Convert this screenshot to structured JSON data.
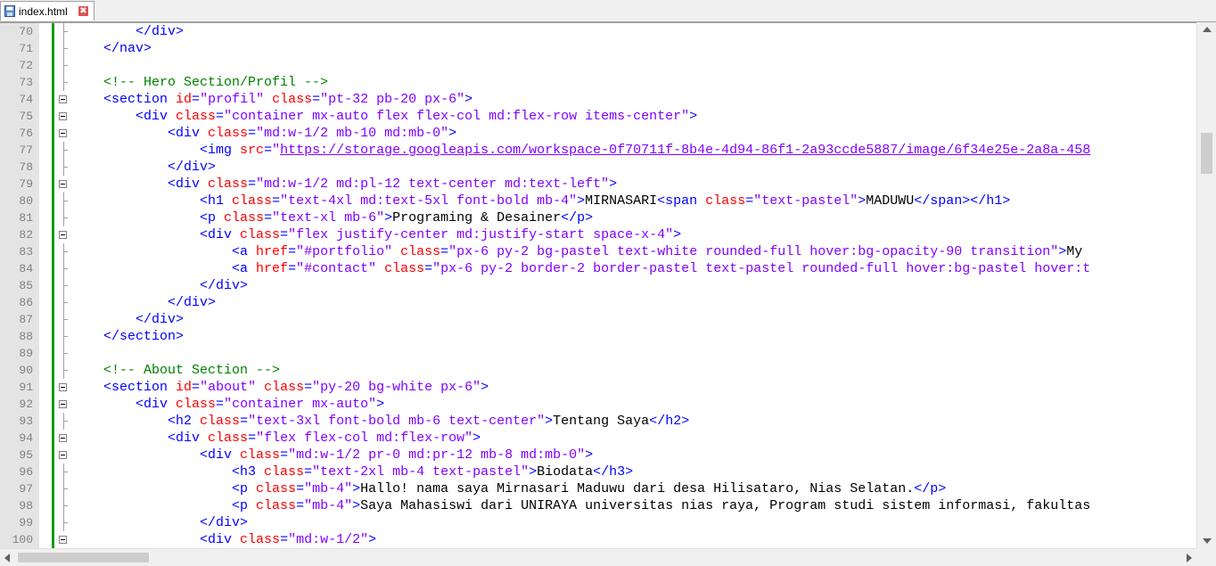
{
  "tab": {
    "filename": "index.html",
    "icon": "file-save-icon",
    "close": "✖"
  },
  "colors": {
    "tag": "#0000ff",
    "attr": "#ff0000",
    "string": "#8000ff",
    "comment": "#008000",
    "text": "#000000",
    "change_bar": "#10a010"
  },
  "fold_lines": [
    74,
    75,
    76,
    79,
    82,
    91,
    92,
    94,
    95,
    100
  ],
  "lines": [
    {
      "n": "70",
      "tokens": [
        [
          "",
          "        "
        ],
        [
          "tag",
          "</div>"
        ]
      ]
    },
    {
      "n": "71",
      "tokens": [
        [
          "",
          "    "
        ],
        [
          "tag",
          "</nav>"
        ]
      ]
    },
    {
      "n": "72",
      "tokens": []
    },
    {
      "n": "73",
      "tokens": [
        [
          "",
          "    "
        ],
        [
          "com",
          "<!-- Hero Section/Profil -->"
        ]
      ]
    },
    {
      "n": "74",
      "tokens": [
        [
          "",
          "    "
        ],
        [
          "tag",
          "<section "
        ],
        [
          "attr",
          "id"
        ],
        [
          "tag",
          "="
        ],
        [
          "str",
          "\"profil\""
        ],
        [
          "tag",
          " "
        ],
        [
          "attr",
          "class"
        ],
        [
          "tag",
          "="
        ],
        [
          "str",
          "\"pt-32 pb-20 px-6\""
        ],
        [
          "tag",
          ">"
        ]
      ]
    },
    {
      "n": "75",
      "tokens": [
        [
          "",
          "        "
        ],
        [
          "tag",
          "<div "
        ],
        [
          "attr",
          "class"
        ],
        [
          "tag",
          "="
        ],
        [
          "str",
          "\"container mx-auto flex flex-col md:flex-row items-center\""
        ],
        [
          "tag",
          ">"
        ]
      ]
    },
    {
      "n": "76",
      "tokens": [
        [
          "",
          "            "
        ],
        [
          "tag",
          "<div "
        ],
        [
          "attr",
          "class"
        ],
        [
          "tag",
          "="
        ],
        [
          "str",
          "\"md:w-1/2 mb-10 md:mb-0\""
        ],
        [
          "tag",
          ">"
        ]
      ]
    },
    {
      "n": "77",
      "tokens": [
        [
          "",
          "                "
        ],
        [
          "tag",
          "<img "
        ],
        [
          "attr",
          "src"
        ],
        [
          "tag",
          "="
        ],
        [
          "str",
          "\""
        ],
        [
          "url",
          "https://storage.googleapis.com/workspace-0f70711f-8b4e-4d94-86f1-2a93ccde5887/image/6f34e25e-2a8a-458"
        ]
      ]
    },
    {
      "n": "78",
      "tokens": [
        [
          "",
          "            "
        ],
        [
          "tag",
          "</div>"
        ]
      ]
    },
    {
      "n": "79",
      "tokens": [
        [
          "",
          "            "
        ],
        [
          "tag",
          "<div "
        ],
        [
          "attr",
          "class"
        ],
        [
          "tag",
          "="
        ],
        [
          "str",
          "\"md:w-1/2 md:pl-12 text-center md:text-left\""
        ],
        [
          "tag",
          ">"
        ]
      ]
    },
    {
      "n": "80",
      "tokens": [
        [
          "",
          "                "
        ],
        [
          "tag",
          "<h1 "
        ],
        [
          "attr",
          "class"
        ],
        [
          "tag",
          "="
        ],
        [
          "str",
          "\"text-4xl md:text-5xl font-bold mb-4\""
        ],
        [
          "tag",
          ">"
        ],
        [
          "text",
          "MIRNASARI"
        ],
        [
          "tag",
          "<span "
        ],
        [
          "attr",
          "class"
        ],
        [
          "tag",
          "="
        ],
        [
          "str",
          "\"text-pastel\""
        ],
        [
          "tag",
          ">"
        ],
        [
          "text",
          "MADUWU"
        ],
        [
          "tag",
          "</span></h1>"
        ]
      ]
    },
    {
      "n": "81",
      "tokens": [
        [
          "",
          "                "
        ],
        [
          "tag",
          "<p "
        ],
        [
          "attr",
          "class"
        ],
        [
          "tag",
          "="
        ],
        [
          "str",
          "\"text-xl mb-6\""
        ],
        [
          "tag",
          ">"
        ],
        [
          "text",
          "Programing & Desainer"
        ],
        [
          "tag",
          "</p>"
        ]
      ]
    },
    {
      "n": "82",
      "tokens": [
        [
          "",
          "                "
        ],
        [
          "tag",
          "<div "
        ],
        [
          "attr",
          "class"
        ],
        [
          "tag",
          "="
        ],
        [
          "str",
          "\"flex justify-center md:justify-start space-x-4\""
        ],
        [
          "tag",
          ">"
        ]
      ]
    },
    {
      "n": "83",
      "tokens": [
        [
          "",
          "                    "
        ],
        [
          "tag",
          "<a "
        ],
        [
          "attr",
          "href"
        ],
        [
          "tag",
          "="
        ],
        [
          "str",
          "\"#portfolio\""
        ],
        [
          "tag",
          " "
        ],
        [
          "attr",
          "class"
        ],
        [
          "tag",
          "="
        ],
        [
          "str",
          "\"px-6 py-2 bg-pastel text-white rounded-full hover:bg-opacity-90 transition\""
        ],
        [
          "tag",
          ">"
        ],
        [
          "text",
          "My"
        ]
      ]
    },
    {
      "n": "84",
      "tokens": [
        [
          "",
          "                    "
        ],
        [
          "tag",
          "<a "
        ],
        [
          "attr",
          "href"
        ],
        [
          "tag",
          "="
        ],
        [
          "str",
          "\"#contact\""
        ],
        [
          "tag",
          " "
        ],
        [
          "attr",
          "class"
        ],
        [
          "tag",
          "="
        ],
        [
          "str",
          "\"px-6 py-2 border-2 border-pastel text-pastel rounded-full hover:bg-pastel hover:t"
        ]
      ]
    },
    {
      "n": "85",
      "tokens": [
        [
          "",
          "                "
        ],
        [
          "tag",
          "</div>"
        ]
      ]
    },
    {
      "n": "86",
      "tokens": [
        [
          "",
          "            "
        ],
        [
          "tag",
          "</div>"
        ]
      ]
    },
    {
      "n": "87",
      "tokens": [
        [
          "",
          "        "
        ],
        [
          "tag",
          "</div>"
        ]
      ]
    },
    {
      "n": "88",
      "tokens": [
        [
          "",
          "    "
        ],
        [
          "tag",
          "</section>"
        ]
      ]
    },
    {
      "n": "89",
      "tokens": []
    },
    {
      "n": "90",
      "tokens": [
        [
          "",
          "    "
        ],
        [
          "com",
          "<!-- About Section -->"
        ]
      ]
    },
    {
      "n": "91",
      "tokens": [
        [
          "",
          "    "
        ],
        [
          "tag",
          "<section "
        ],
        [
          "attr",
          "id"
        ],
        [
          "tag",
          "="
        ],
        [
          "str",
          "\"about\""
        ],
        [
          "tag",
          " "
        ],
        [
          "attr",
          "class"
        ],
        [
          "tag",
          "="
        ],
        [
          "str",
          "\"py-20 bg-white px-6\""
        ],
        [
          "tag",
          ">"
        ]
      ]
    },
    {
      "n": "92",
      "tokens": [
        [
          "",
          "        "
        ],
        [
          "tag",
          "<div "
        ],
        [
          "attr",
          "class"
        ],
        [
          "tag",
          "="
        ],
        [
          "str",
          "\"container mx-auto\""
        ],
        [
          "tag",
          ">"
        ]
      ]
    },
    {
      "n": "93",
      "tokens": [
        [
          "",
          "            "
        ],
        [
          "tag",
          "<h2 "
        ],
        [
          "attr",
          "class"
        ],
        [
          "tag",
          "="
        ],
        [
          "str",
          "\"text-3xl font-bold mb-6 text-center\""
        ],
        [
          "tag",
          ">"
        ],
        [
          "text",
          "Tentang Saya"
        ],
        [
          "tag",
          "</h2>"
        ]
      ]
    },
    {
      "n": "94",
      "tokens": [
        [
          "",
          "            "
        ],
        [
          "tag",
          "<div "
        ],
        [
          "attr",
          "class"
        ],
        [
          "tag",
          "="
        ],
        [
          "str",
          "\"flex flex-col md:flex-row\""
        ],
        [
          "tag",
          ">"
        ]
      ]
    },
    {
      "n": "95",
      "tokens": [
        [
          "",
          "                "
        ],
        [
          "tag",
          "<div "
        ],
        [
          "attr",
          "class"
        ],
        [
          "tag",
          "="
        ],
        [
          "str",
          "\"md:w-1/2 pr-0 md:pr-12 mb-8 md:mb-0\""
        ],
        [
          "tag",
          ">"
        ]
      ]
    },
    {
      "n": "96",
      "tokens": [
        [
          "",
          "                    "
        ],
        [
          "tag",
          "<h3 "
        ],
        [
          "attr",
          "class"
        ],
        [
          "tag",
          "="
        ],
        [
          "str",
          "\"text-2xl mb-4 text-pastel\""
        ],
        [
          "tag",
          ">"
        ],
        [
          "text",
          "Biodata"
        ],
        [
          "tag",
          "</h3>"
        ]
      ]
    },
    {
      "n": "97",
      "tokens": [
        [
          "",
          "                    "
        ],
        [
          "tag",
          "<p "
        ],
        [
          "attr",
          "class"
        ],
        [
          "tag",
          "="
        ],
        [
          "str",
          "\"mb-4\""
        ],
        [
          "tag",
          ">"
        ],
        [
          "text",
          "Hallo! nama saya Mirnasari Maduwu dari desa Hilisataro, Nias Selatan."
        ],
        [
          "tag",
          "</p>"
        ]
      ]
    },
    {
      "n": "98",
      "tokens": [
        [
          "",
          "                    "
        ],
        [
          "tag",
          "<p "
        ],
        [
          "attr",
          "class"
        ],
        [
          "tag",
          "="
        ],
        [
          "str",
          "\"mb-4\""
        ],
        [
          "tag",
          ">"
        ],
        [
          "text",
          "Saya Mahasiswi dari UNIRAYA universitas nias raya, Program studi sistem informasi, fakultas"
        ]
      ]
    },
    {
      "n": "99",
      "tokens": [
        [
          "",
          "                "
        ],
        [
          "tag",
          "</div>"
        ]
      ]
    },
    {
      "n": "100",
      "tokens": [
        [
          "",
          "                "
        ],
        [
          "tag",
          "<div "
        ],
        [
          "attr",
          "class"
        ],
        [
          "tag",
          "="
        ],
        [
          "str",
          "\"md:w-1/2\""
        ],
        [
          "tag",
          ">"
        ]
      ]
    }
  ]
}
